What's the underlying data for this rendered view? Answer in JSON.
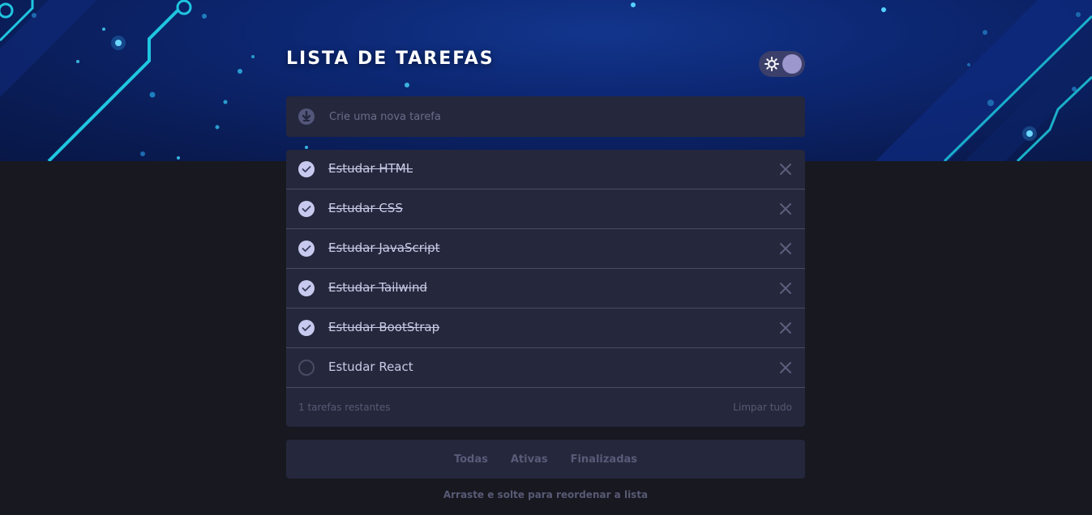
{
  "header": {
    "title": "LISTA DE TAREFAS"
  },
  "theme_toggle": {
    "icon": "sun-icon"
  },
  "new_task": {
    "placeholder": "Crie uma nova tarefa",
    "icon": "download-icon"
  },
  "tasks": [
    {
      "label": "Estudar HTML",
      "done": true
    },
    {
      "label": "Estudar CSS",
      "done": true
    },
    {
      "label": "Estudar JavaScript",
      "done": true
    },
    {
      "label": "Estudar Tailwind",
      "done": true
    },
    {
      "label": "Estudar BootStrap",
      "done": true
    },
    {
      "label": "Estudar React",
      "done": false
    }
  ],
  "footer": {
    "remaining": "1 tarefas restantes",
    "clear_label": "Limpar tudo"
  },
  "filters": [
    "Todas",
    "Ativas",
    "Finalizadas"
  ],
  "hint": "Arraste e solte para reordenar a lista",
  "colors": {
    "background": "#181820",
    "card": "#25273c",
    "check_done": "#c8c9ee",
    "accent_circuit": "#1fc6e0"
  }
}
